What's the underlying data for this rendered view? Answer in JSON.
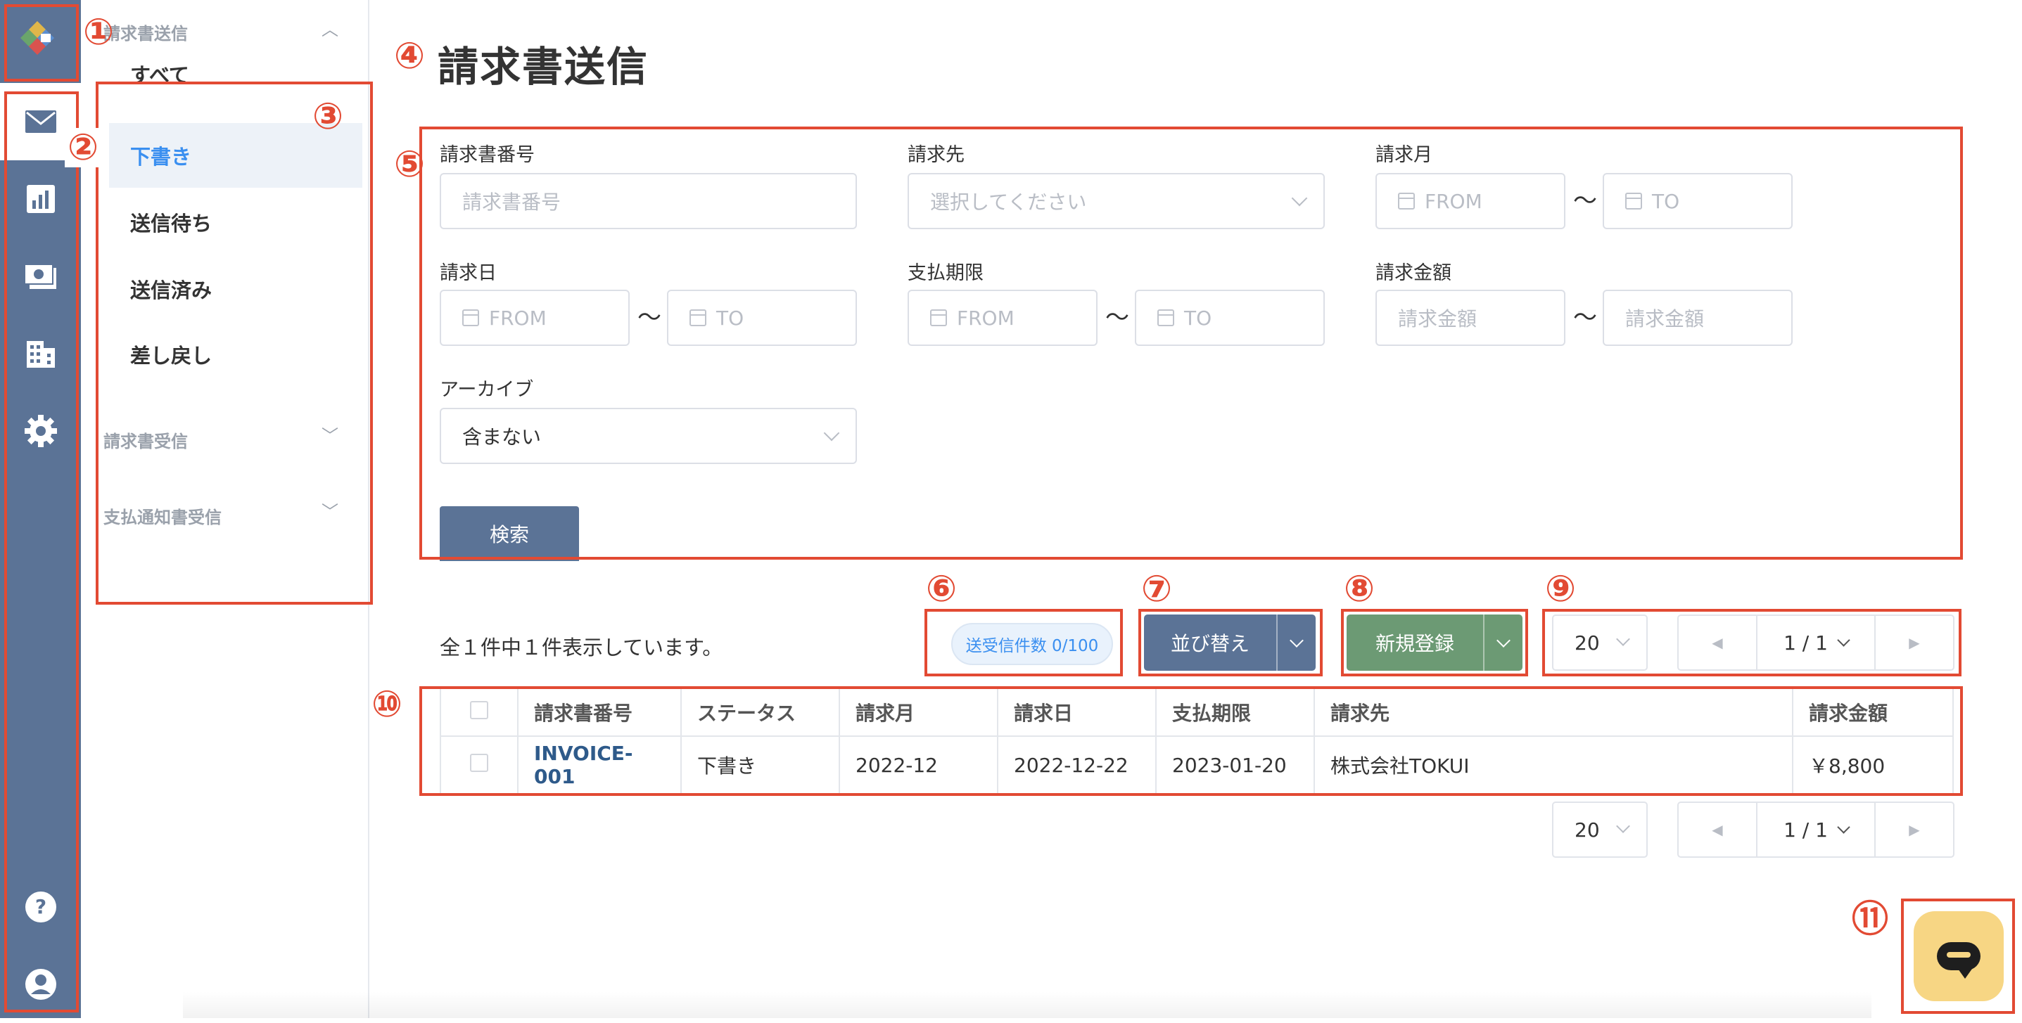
{
  "sidebar_icons": [
    "logo-icon",
    "mail-icon",
    "chart-icon",
    "money-icon",
    "building-icon",
    "gear-icon",
    "help-icon",
    "user-icon"
  ],
  "submenu": {
    "section_send": "請求書送信",
    "items": [
      "すべて",
      "下書き",
      "送信待ち",
      "送信済み",
      "差し戻し"
    ],
    "active_index": 1,
    "section_receive": "請求書受信",
    "section_payment": "支払通知書受信"
  },
  "page": {
    "title": "請求書送信"
  },
  "filters": {
    "invoice_number": {
      "label": "請求書番号",
      "placeholder": "請求書番号"
    },
    "customer": {
      "label": "請求先",
      "placeholder": "選択してください"
    },
    "billing_month": {
      "label": "請求月",
      "from": "FROM",
      "to": "TO"
    },
    "billing_date": {
      "label": "請求日",
      "from": "FROM",
      "to": "TO"
    },
    "due_date": {
      "label": "支払期限",
      "from": "FROM",
      "to": "TO"
    },
    "amount": {
      "label": "請求金額",
      "from": "請求金額",
      "to": "請求金額"
    },
    "archive": {
      "label": "アーカイブ",
      "value": "含まない"
    },
    "tilde": "〜",
    "search_button": "検索"
  },
  "toolbar": {
    "count_text": "全１件中１件表示しています。",
    "usage_badge": "送受信件数 0/100",
    "sort_button": "並び替え",
    "new_button": "新規登録",
    "page_size": "20",
    "page_indicator": "1 / 1"
  },
  "table": {
    "headers": [
      "請求書番号",
      "ステータス",
      "請求月",
      "請求日",
      "支払期限",
      "請求先",
      "請求金額"
    ],
    "rows": [
      [
        "INVOICE-001",
        "下書き",
        "2022-12",
        "2022-12-22",
        "2023-01-20",
        "株式会社TOKUI",
        "￥8,800"
      ]
    ]
  },
  "annotations": [
    "①",
    "②",
    "③",
    "④",
    "⑤",
    "⑥",
    "⑦",
    "⑧",
    "⑨",
    "⑩",
    "⑪"
  ],
  "colors": {
    "rail": "#5b7396",
    "accent": "#3a8ff0",
    "new_button": "#6c9a74",
    "annotation": "#e24a33",
    "chat": "#f7d684"
  }
}
